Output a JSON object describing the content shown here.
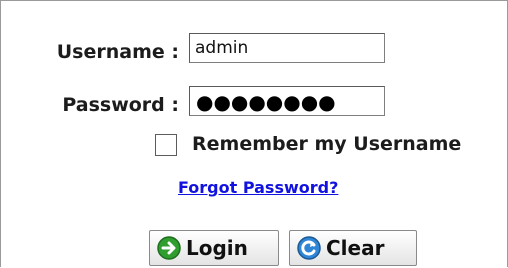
{
  "form": {
    "username_label": "Username :",
    "password_label": "Password :",
    "username_value": "admin",
    "password_mask": "●●●●●●●●",
    "remember_label": "Remember my Username",
    "remember_checked": false,
    "forgot_link": "Forgot Password?"
  },
  "buttons": {
    "login_label": "Login",
    "login_icon": "arrow-right-circle-icon",
    "clear_label": "Clear",
    "clear_icon": "refresh-icon"
  },
  "colors": {
    "link": "#1212e0",
    "login_icon": "#2f9e2f",
    "clear_icon": "#2f86d6"
  }
}
